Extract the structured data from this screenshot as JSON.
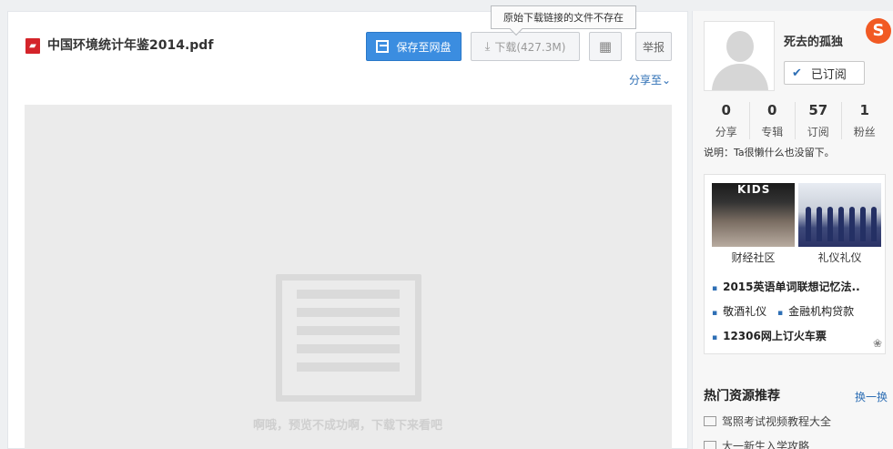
{
  "document": {
    "title": "中国环境统计年鉴2014.pdf",
    "file_icon": "pdf-icon"
  },
  "toolbar": {
    "save_label": "保存至网盘",
    "download_label": "下载(427.3M)",
    "qr_icon": "qrcode-icon",
    "report_label": "举报",
    "tooltip": "原始下载链接的文件不存在",
    "share_label": "分享至"
  },
  "preview": {
    "message": "啊哦，预览不成功啊，下载下来看吧"
  },
  "user": {
    "name": "死去的孤独",
    "subscribed_label": "已订阅",
    "stats": [
      {
        "value": "0",
        "label": "分享"
      },
      {
        "value": "0",
        "label": "专辑"
      },
      {
        "value": "57",
        "label": "订阅"
      },
      {
        "value": "1",
        "label": "粉丝"
      }
    ],
    "description": "说明：Ta很懒什么也没留下。"
  },
  "ad": {
    "image_text": "KIDS",
    "captions": [
      "财经社区",
      "礼仪礼仪"
    ],
    "links": [
      "2015英语单词联想记忆法..",
      "敬酒礼仪",
      "金融机构贷款",
      "12306网上订火车票"
    ]
  },
  "hot": {
    "title": "热门资源推荐",
    "swap_label": "换一换",
    "items": [
      "驾照考试视频教程大全",
      "大一新生入学攻略"
    ]
  },
  "colors": {
    "primary_blue": "#3b8de0",
    "link_blue": "#2e6fb5",
    "pdf_red": "#d4242a",
    "sogou_orange": "#f15a24"
  }
}
